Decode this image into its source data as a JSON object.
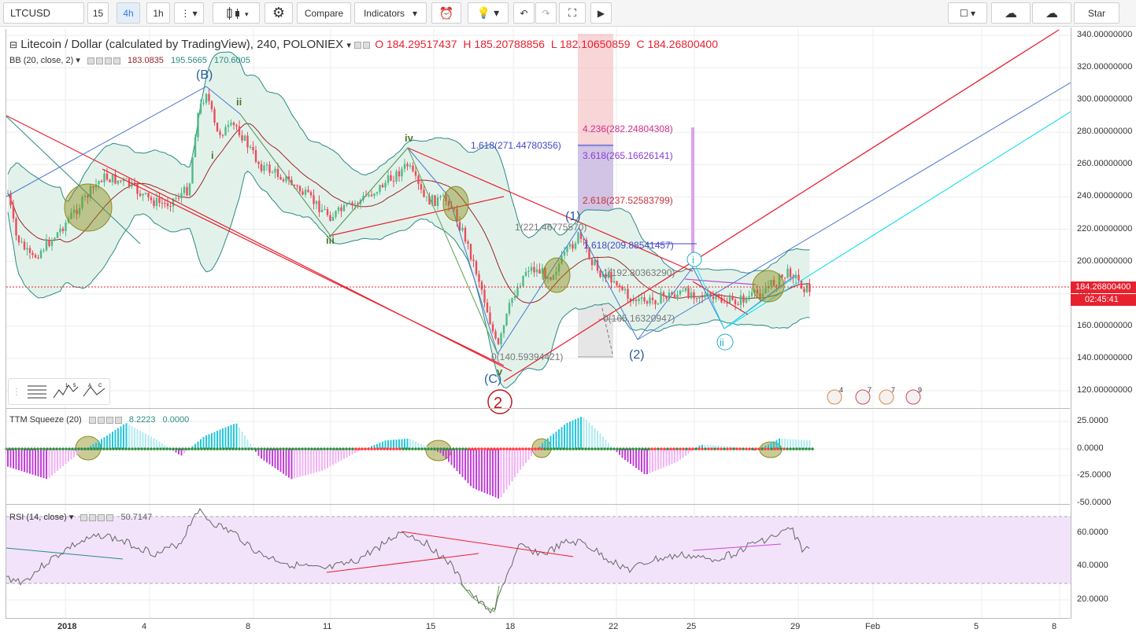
{
  "toolbar": {
    "symbol": "LTCUSD",
    "intervals": [
      "15",
      "4h",
      "1h"
    ],
    "compare": "Compare",
    "indicators": "Indicators",
    "star": "Star"
  },
  "colors": {
    "up": "#53b987",
    "down": "#eb4d5c",
    "bb_fill": "#e7f4ef",
    "bb_line": "#2a8a84",
    "red_line": "#e8212f",
    "blue_line": "#4a78d1",
    "cyan_line": "#23e1f0",
    "rsi_bg": "#f2e3fa"
  },
  "main": {
    "title": "Litecoin / Dollar (calculated by TradingView), 240, POLONIEX",
    "o": "O 184.29517437",
    "h": "H 185.20788856",
    "l": "L 182.10650859",
    "c": "C 184.26800400",
    "bb_label": "BB (20, close, 2)",
    "bb_values": [
      "183.0835",
      "195.5665",
      "170.6005"
    ],
    "price_axis": [
      "340.00000000",
      "320.00000000",
      "300.00000000",
      "280.00000000",
      "260.00000000",
      "240.00000000",
      "220.00000000",
      "200.00000000",
      "180",
      "160.00000000",
      "140.00000000",
      "120.00000000"
    ],
    "last_price": "184.26800400",
    "countdown": "02:45:41",
    "fib": [
      "4.236(282.24804308)",
      "3.618(265.16626141)",
      "2.618(237.52583799)",
      "1.618(271.44780356)",
      "1(221.46775570)",
      "1.618(209.88541457)",
      "1(192.80363290)",
      "0(165.16320947)",
      "0(140.59394421)"
    ],
    "waves": [
      "(B)",
      "ii",
      "i",
      "iv",
      "iii",
      "v",
      "(C)",
      "(1)",
      "(2)",
      "i",
      "ii",
      "2"
    ],
    "events": [
      "4",
      "7",
      "7",
      "9"
    ]
  },
  "squeeze": {
    "label": "TTM Squeeze (20)",
    "values": [
      "8.2223",
      "0.0000"
    ],
    "axis": [
      "25.0000",
      "0.0000",
      "-25.0000",
      "-50.0000"
    ]
  },
  "rsi": {
    "label": "RSI (14, close)",
    "value": "50.7147",
    "axis": [
      "60.0000",
      "40.0000",
      "20.0000"
    ]
  },
  "time_axis": [
    "2018",
    "4",
    "8",
    "11",
    "15",
    "18",
    "22",
    "25",
    "29",
    "Feb",
    "5",
    "8"
  ]
}
